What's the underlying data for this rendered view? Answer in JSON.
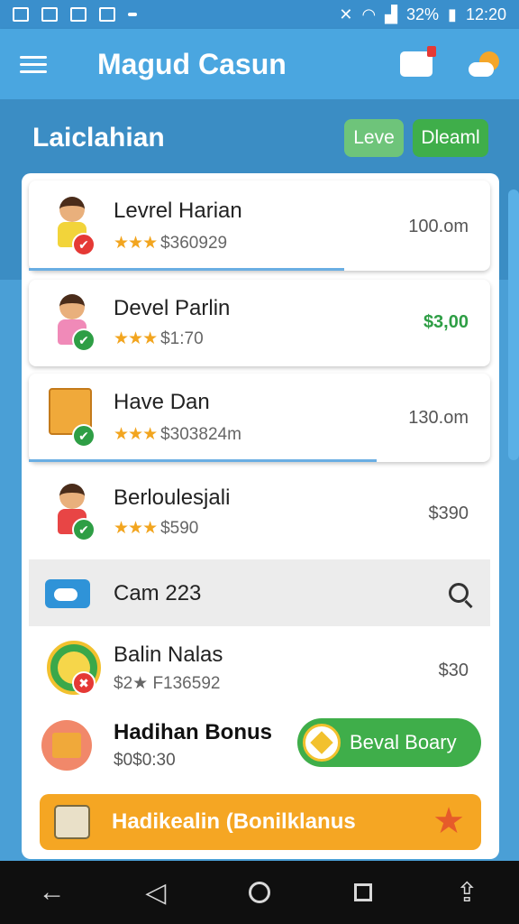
{
  "status_bar": {
    "battery": "32%",
    "time": "12:20"
  },
  "app_bar": {
    "title": "Magud Casun"
  },
  "section": {
    "title": "Laiclahian",
    "pill_leve": "Leve",
    "pill_clear": "Dleaml"
  },
  "items": [
    {
      "title": "Levrel Harian",
      "stars": "★★★",
      "sub": "$360929",
      "amount": "100.om",
      "badge": "✔"
    },
    {
      "title": "Devel Parlin",
      "stars": "★★★",
      "sub": "$1:70",
      "amount": "$3,00",
      "badge": "✔"
    },
    {
      "title": "Have Dan",
      "stars": "★★★",
      "sub": "$303824m",
      "amount": "130.om",
      "badge": "✔"
    },
    {
      "title": "Berloulesjali",
      "stars": "★★★",
      "sub": "$590",
      "amount": "$390",
      "badge": "✔"
    }
  ],
  "search_row": {
    "label": "Cam 223"
  },
  "balin": {
    "title": "Balin Nalas",
    "sub": "$2★ F136592",
    "amount": "$30",
    "badge": "✖"
  },
  "bonus": {
    "title": "Hadihan Bonus",
    "sub": "$0$0:30",
    "button": "Beval Boary"
  },
  "orange_button": {
    "label": "Hadikealin (Bonilklanus"
  },
  "nav": {
    "back": "←",
    "triangle": "◁",
    "share": "⇪"
  },
  "colors": {
    "primary": "#4aa6e0",
    "green": "#3fae4a",
    "orange": "#f5a623"
  }
}
